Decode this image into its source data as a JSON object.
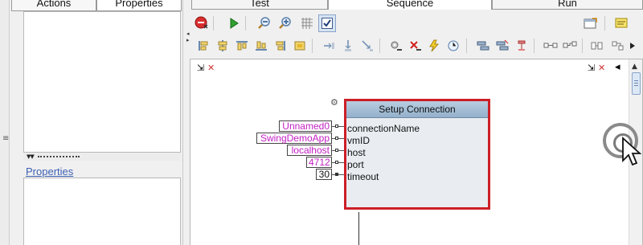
{
  "left_panel": {
    "tabs": [
      {
        "label": "Actions"
      },
      {
        "label": "Properties"
      }
    ],
    "properties_title": "Properties"
  },
  "main_tabs": [
    {
      "label": "Test"
    },
    {
      "label": "Sequence"
    },
    {
      "label": "Run"
    }
  ],
  "toolbar": {
    "primary_icons": [
      "stop-icon",
      "run-icon",
      "zoom-out-icon",
      "zoom-in-icon",
      "grid-icon",
      "checkbox-icon"
    ],
    "secondary_icons": [
      "align-left-icon",
      "align-center-icon",
      "align-top-icon",
      "align-bottom-icon",
      "align-right-icon",
      "align-middle-icon",
      "step-in-icon",
      "step-down-icon",
      "step-out-icon",
      "settings-icon",
      "breakpoint-icon",
      "run-to-icon",
      "watch-icon",
      "connect-icon",
      "disconnect-icon",
      "port-icon",
      "link-icon",
      "unlink-icon"
    ],
    "right_icons": [
      "export-icon",
      "notes-icon"
    ]
  },
  "block": {
    "title": "Setup Connection",
    "ports": [
      {
        "name": "connectionName",
        "value": "Unnamed0"
      },
      {
        "name": "vmID",
        "value": "SwingDemoApp"
      },
      {
        "name": "host",
        "value": "localhost"
      },
      {
        "name": "port",
        "value": "4712"
      },
      {
        "name": "timeout",
        "value": "30"
      }
    ]
  },
  "colors": {
    "block_border": "#cc1f27",
    "input_value_text": "#c21fc2",
    "block_header": "#a6bfd6"
  }
}
